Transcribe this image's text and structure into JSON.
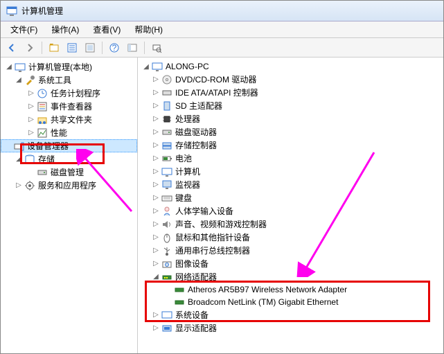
{
  "window": {
    "title": "计算机管理"
  },
  "menu": {
    "file": "文件(F)",
    "action": "操作(A)",
    "view": "查看(V)",
    "help": "帮助(H)"
  },
  "leftTree": {
    "root": "计算机管理(本地)",
    "sysTools": "系统工具",
    "taskScheduler": "任务计划程序",
    "eventViewer": "事件查看器",
    "sharedFolders": "共享文件夹",
    "performance": "性能",
    "deviceManager": "设备管理器",
    "storage": "存储",
    "diskMgmt": "磁盘管理",
    "servicesApps": "服务和应用程序"
  },
  "rightTree": {
    "root": "ALONG-PC",
    "dvd": "DVD/CD-ROM 驱动器",
    "ide": "IDE ATA/ATAPI 控制器",
    "sd": "SD 主适配器",
    "cpu": "处理器",
    "diskDrive": "磁盘驱动器",
    "storageCtrl": "存储控制器",
    "battery": "电池",
    "computer": "计算机",
    "monitor": "监视器",
    "keyboard": "键盘",
    "hid": "人体学输入设备",
    "sound": "声音、视频和游戏控制器",
    "mouse": "鼠标和其他指针设备",
    "usb": "通用串行总线控制器",
    "imaging": "图像设备",
    "network": "网络适配器",
    "netAdapter1": "Atheros AR5B97 Wireless Network Adapter",
    "netAdapter2": "Broadcom NetLink (TM) Gigabit Ethernet",
    "sysDevices": "系统设备",
    "display": "显示适配器"
  }
}
